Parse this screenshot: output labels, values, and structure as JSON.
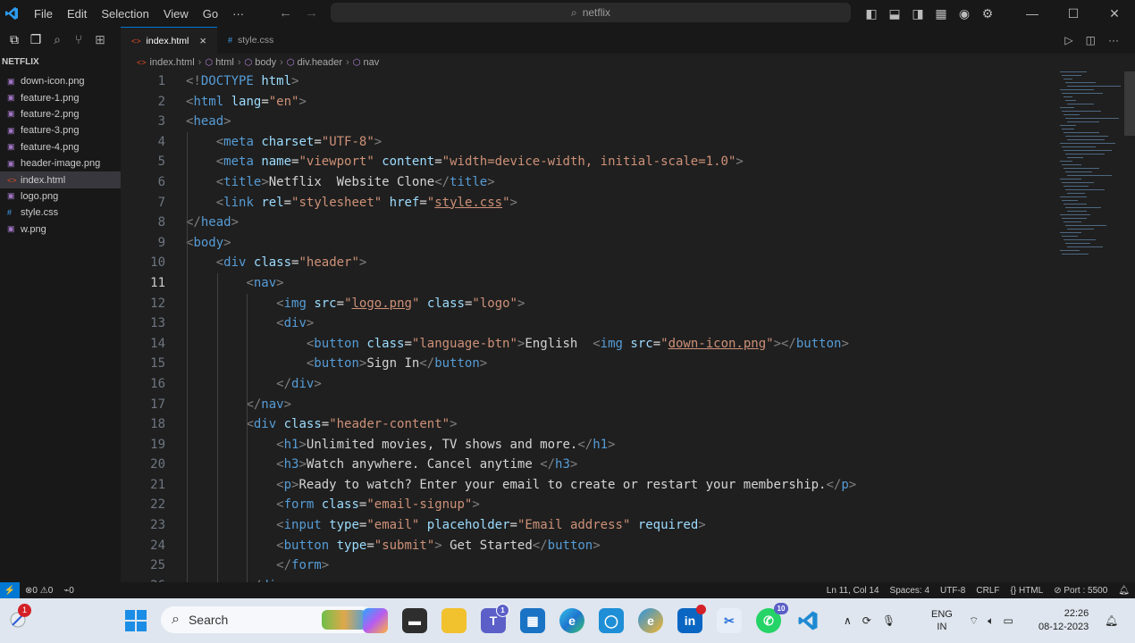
{
  "titlebar": {
    "menus": [
      "File",
      "Edit",
      "Selection",
      "View",
      "Go",
      "···"
    ],
    "search": "netflix",
    "icons": [
      "vscode-logo-icon",
      "back-arrow-icon",
      "forward-arrow-icon",
      "toggle-sidebar-icon",
      "toggle-panel-icon",
      "toggle-secondary-sidebar-icon",
      "customize-layout-icon",
      "account-icon",
      "settings-gear-icon",
      "minimize-icon",
      "maximize-icon",
      "close-icon"
    ]
  },
  "explorer": {
    "title": "NETFLIX",
    "files": [
      {
        "name": "down-icon.png",
        "kind": "png"
      },
      {
        "name": "feature-1.png",
        "kind": "png"
      },
      {
        "name": "feature-2.png",
        "kind": "png"
      },
      {
        "name": "feature-3.png",
        "kind": "png"
      },
      {
        "name": "feature-4.png",
        "kind": "png"
      },
      {
        "name": "header-image.png",
        "kind": "png"
      },
      {
        "name": "index.html",
        "kind": "html",
        "active": true
      },
      {
        "name": "logo.png",
        "kind": "png"
      },
      {
        "name": "style.css",
        "kind": "css"
      },
      {
        "name": "w.png",
        "kind": "png"
      }
    ]
  },
  "tabs": [
    {
      "label": "index.html",
      "icon": "<>",
      "active": true,
      "close": "×"
    },
    {
      "label": "style.css",
      "icon": "#",
      "active": false
    }
  ],
  "breadcrumb": [
    "index.html",
    "html",
    "body",
    "div.header",
    "nav"
  ],
  "editor": {
    "current_line": 11,
    "lines": [
      [
        [
          "br",
          "<!"
        ],
        [
          "t",
          "DOCTYPE"
        ],
        [
          "tx",
          " "
        ],
        [
          "at",
          "html"
        ],
        [
          "br",
          ">"
        ]
      ],
      [
        [
          "br",
          "<"
        ],
        [
          "t",
          "html"
        ],
        [
          "tx",
          " "
        ],
        [
          "at",
          "lang"
        ],
        [
          "tx",
          "="
        ],
        [
          "st",
          "\"en\""
        ],
        [
          "br",
          ">"
        ]
      ],
      [
        [
          "br",
          "<"
        ],
        [
          "t",
          "head"
        ],
        [
          "br",
          ">"
        ]
      ],
      [
        [
          "tx",
          "    "
        ],
        [
          "br",
          "<"
        ],
        [
          "t",
          "meta"
        ],
        [
          "tx",
          " "
        ],
        [
          "at",
          "charset"
        ],
        [
          "tx",
          "="
        ],
        [
          "st",
          "\"UTF-8\""
        ],
        [
          "br",
          ">"
        ]
      ],
      [
        [
          "tx",
          "    "
        ],
        [
          "br",
          "<"
        ],
        [
          "t",
          "meta"
        ],
        [
          "tx",
          " "
        ],
        [
          "at",
          "name"
        ],
        [
          "tx",
          "="
        ],
        [
          "st",
          "\"viewport\""
        ],
        [
          "tx",
          " "
        ],
        [
          "at",
          "content"
        ],
        [
          "tx",
          "="
        ],
        [
          "st",
          "\"width=device-width, initial-scale=1.0\""
        ],
        [
          "br",
          ">"
        ]
      ],
      [
        [
          "tx",
          "    "
        ],
        [
          "br",
          "<"
        ],
        [
          "t",
          "title"
        ],
        [
          "br",
          ">"
        ],
        [
          "tx",
          "Netflix  Website Clone"
        ],
        [
          "br",
          "</"
        ],
        [
          "t",
          "title"
        ],
        [
          "br",
          ">"
        ]
      ],
      [
        [
          "tx",
          "    "
        ],
        [
          "br",
          "<"
        ],
        [
          "t",
          "link"
        ],
        [
          "tx",
          " "
        ],
        [
          "at",
          "rel"
        ],
        [
          "tx",
          "="
        ],
        [
          "st",
          "\"stylesheet\""
        ],
        [
          "tx",
          " "
        ],
        [
          "at",
          "href"
        ],
        [
          "tx",
          "="
        ],
        [
          "st",
          "\""
        ],
        [
          "su",
          "style.css"
        ],
        [
          "st",
          "\""
        ],
        [
          "br",
          ">"
        ]
      ],
      [
        [
          "br",
          "</"
        ],
        [
          "t",
          "head"
        ],
        [
          "br",
          ">"
        ]
      ],
      [
        [
          "br",
          "<"
        ],
        [
          "t",
          "body"
        ],
        [
          "br",
          ">"
        ]
      ],
      [
        [
          "tx",
          "    "
        ],
        [
          "br",
          "<"
        ],
        [
          "t",
          "div"
        ],
        [
          "tx",
          " "
        ],
        [
          "at",
          "class"
        ],
        [
          "tx",
          "="
        ],
        [
          "st",
          "\"header\""
        ],
        [
          "br",
          ">"
        ]
      ],
      [
        [
          "tx",
          "        "
        ],
        [
          "br",
          "<"
        ],
        [
          "t",
          "nav"
        ],
        [
          "br",
          ">"
        ]
      ],
      [
        [
          "tx",
          "            "
        ],
        [
          "br",
          "<"
        ],
        [
          "t",
          "img"
        ],
        [
          "tx",
          " "
        ],
        [
          "at",
          "src"
        ],
        [
          "tx",
          "="
        ],
        [
          "st",
          "\""
        ],
        [
          "su",
          "logo.png"
        ],
        [
          "st",
          "\""
        ],
        [
          "tx",
          " "
        ],
        [
          "at",
          "class"
        ],
        [
          "tx",
          "="
        ],
        [
          "st",
          "\"logo\""
        ],
        [
          "br",
          ">"
        ]
      ],
      [
        [
          "tx",
          "            "
        ],
        [
          "br",
          "<"
        ],
        [
          "t",
          "div"
        ],
        [
          "br",
          ">"
        ]
      ],
      [
        [
          "tx",
          "                "
        ],
        [
          "br",
          "<"
        ],
        [
          "t",
          "button"
        ],
        [
          "tx",
          " "
        ],
        [
          "at",
          "class"
        ],
        [
          "tx",
          "="
        ],
        [
          "st",
          "\"language-btn\""
        ],
        [
          "br",
          ">"
        ],
        [
          "tx",
          "English  "
        ],
        [
          "br",
          "<"
        ],
        [
          "t",
          "img"
        ],
        [
          "tx",
          " "
        ],
        [
          "at",
          "src"
        ],
        [
          "tx",
          "="
        ],
        [
          "st",
          "\""
        ],
        [
          "su",
          "down-icon.png"
        ],
        [
          "st",
          "\""
        ],
        [
          "br",
          "></"
        ],
        [
          "t",
          "button"
        ],
        [
          "br",
          ">"
        ]
      ],
      [
        [
          "tx",
          "                "
        ],
        [
          "br",
          "<"
        ],
        [
          "t",
          "button"
        ],
        [
          "br",
          ">"
        ],
        [
          "tx",
          "Sign In"
        ],
        [
          "br",
          "</"
        ],
        [
          "t",
          "button"
        ],
        [
          "br",
          ">"
        ]
      ],
      [
        [
          "tx",
          "            "
        ],
        [
          "br",
          "</"
        ],
        [
          "t",
          "div"
        ],
        [
          "br",
          ">"
        ]
      ],
      [
        [
          "tx",
          "        "
        ],
        [
          "br",
          "</"
        ],
        [
          "t",
          "nav"
        ],
        [
          "br",
          ">"
        ]
      ],
      [
        [
          "tx",
          "        "
        ],
        [
          "br",
          "<"
        ],
        [
          "t",
          "div"
        ],
        [
          "tx",
          " "
        ],
        [
          "at",
          "class"
        ],
        [
          "tx",
          "="
        ],
        [
          "st",
          "\"header-content\""
        ],
        [
          "br",
          ">"
        ]
      ],
      [
        [
          "tx",
          "            "
        ],
        [
          "br",
          "<"
        ],
        [
          "t",
          "h1"
        ],
        [
          "br",
          ">"
        ],
        [
          "tx",
          "Unlimited movies, TV shows and more."
        ],
        [
          "br",
          "</"
        ],
        [
          "t",
          "h1"
        ],
        [
          "br",
          ">"
        ]
      ],
      [
        [
          "tx",
          "            "
        ],
        [
          "br",
          "<"
        ],
        [
          "t",
          "h3"
        ],
        [
          "br",
          ">"
        ],
        [
          "tx",
          "Watch anywhere. Cancel anytime "
        ],
        [
          "br",
          "</"
        ],
        [
          "t",
          "h3"
        ],
        [
          "br",
          ">"
        ]
      ],
      [
        [
          "tx",
          "            "
        ],
        [
          "br",
          "<"
        ],
        [
          "t",
          "p"
        ],
        [
          "br",
          ">"
        ],
        [
          "tx",
          "Ready to watch? Enter your email to create or restart your membership."
        ],
        [
          "br",
          "</"
        ],
        [
          "t",
          "p"
        ],
        [
          "br",
          ">"
        ]
      ],
      [
        [
          "tx",
          "            "
        ],
        [
          "br",
          "<"
        ],
        [
          "t",
          "form"
        ],
        [
          "tx",
          " "
        ],
        [
          "at",
          "class"
        ],
        [
          "tx",
          "="
        ],
        [
          "st",
          "\"email-signup\""
        ],
        [
          "br",
          ">"
        ]
      ],
      [
        [
          "tx",
          "            "
        ],
        [
          "br",
          "<"
        ],
        [
          "t",
          "input"
        ],
        [
          "tx",
          " "
        ],
        [
          "at",
          "type"
        ],
        [
          "tx",
          "="
        ],
        [
          "st",
          "\"email\""
        ],
        [
          "tx",
          " "
        ],
        [
          "at",
          "placeholder"
        ],
        [
          "tx",
          "="
        ],
        [
          "st",
          "\"Email address\""
        ],
        [
          "tx",
          " "
        ],
        [
          "at",
          "required"
        ],
        [
          "br",
          ">"
        ]
      ],
      [
        [
          "tx",
          "            "
        ],
        [
          "br",
          "<"
        ],
        [
          "t",
          "button"
        ],
        [
          "tx",
          " "
        ],
        [
          "at",
          "type"
        ],
        [
          "tx",
          "="
        ],
        [
          "st",
          "\"submit\""
        ],
        [
          "br",
          ">"
        ],
        [
          "tx",
          " Get Started"
        ],
        [
          "br",
          "</"
        ],
        [
          "t",
          "button"
        ],
        [
          "br",
          ">"
        ]
      ],
      [
        [
          "tx",
          "            "
        ],
        [
          "br",
          "</"
        ],
        [
          "t",
          "form"
        ],
        [
          "br",
          ">"
        ]
      ],
      [
        [
          "tx",
          "        "
        ],
        [
          "br",
          "</"
        ],
        [
          "t",
          "div"
        ],
        [
          "br",
          ">"
        ]
      ]
    ]
  },
  "statusbar": {
    "errors": "0",
    "warnings": "0",
    "ports": "0",
    "position": "Ln 11, Col 14",
    "spaces": "Spaces: 4",
    "encoding": "UTF-8",
    "eol": "CRLF",
    "language": "HTML",
    "port_label": "Port : 5500"
  },
  "taskbar": {
    "search": "Search",
    "badges": {
      "notifications": "1",
      "teams": "1",
      "whatsapp": "10"
    },
    "lang_top": "ENG",
    "lang_bottom": "IN",
    "time": "22:26",
    "date": "08-12-2023"
  },
  "colors": {
    "accent": "#0078d4",
    "tag": "#569cd6",
    "attr": "#9cdcfe",
    "string": "#ce9178",
    "text": "#d4d4d4",
    "bracket": "#808080"
  }
}
